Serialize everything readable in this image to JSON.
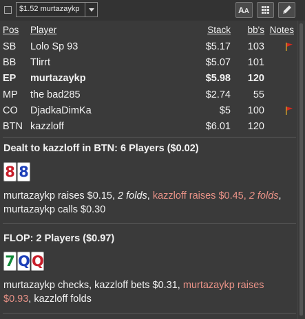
{
  "toolbar": {
    "hand_select_value": "$1.52 murtazaykp",
    "font_button_label_small": "A",
    "font_button_label_big": "A"
  },
  "table_headers": {
    "pos": "Pos",
    "player": "Player",
    "stack": "Stack",
    "bb": "bb's",
    "notes": "Notes"
  },
  "players": [
    {
      "pos": "SB",
      "name": "Lolo Sp 93",
      "stack": "$5.17",
      "bb": "103",
      "flag": true,
      "hero": false
    },
    {
      "pos": "BB",
      "name": "Tlirrt",
      "stack": "$5.07",
      "bb": "101",
      "flag": false,
      "hero": false
    },
    {
      "pos": "EP",
      "name": "murtazaykp",
      "stack": "$5.98",
      "bb": "120",
      "flag": false,
      "hero": true
    },
    {
      "pos": "MP",
      "name": "the bad285",
      "stack": "$2.74",
      "bb": "55",
      "flag": false,
      "hero": false
    },
    {
      "pos": "CO",
      "name": "DjadkaDimKa",
      "stack": "$5",
      "bb": "100",
      "flag": true,
      "hero": false
    },
    {
      "pos": "BTN",
      "name": "kazzloff",
      "stack": "$6.01",
      "bb": "120",
      "flag": false,
      "hero": false
    }
  ],
  "preflop": {
    "title": "Dealt to kazzloff in BTN: 6 Players ($0.02)",
    "cards": [
      {
        "rank": "8",
        "color": "#c81e2a"
      },
      {
        "rank": "8",
        "color": "#1d3fb8"
      }
    ],
    "actions": {
      "a1": "murtazaykp raises $0.15, ",
      "a2": "2 folds",
      "a3": ", ",
      "a4": "kazzloff raises $0.45, ",
      "a5": "2 folds",
      "a6": ", murtazaykp calls $0.30"
    }
  },
  "flop": {
    "title": "FLOP: 2 Players ($0.97)",
    "cards": [
      {
        "rank": "7",
        "color": "#138a3a"
      },
      {
        "rank": "Q",
        "color": "#1d3fb8"
      },
      {
        "rank": "Q",
        "color": "#c81e2a"
      }
    ],
    "actions": {
      "a1": "murtazaykp checks, kazzloff bets $0.31, ",
      "a2": "murtazaykp raises $0.93",
      "a3": ", kazzloff folds"
    }
  },
  "colors": {
    "background": "#3a3a3a",
    "text": "#f2f2f2",
    "highlight": "#e99287",
    "flag_red": "#d42a1e",
    "flag_pole": "#c79a2a"
  },
  "icons": [
    "checkbox",
    "dropdown-arrow-icon",
    "font-size-icon",
    "grid-icon",
    "edit-pencil-icon",
    "flag-icon"
  ]
}
